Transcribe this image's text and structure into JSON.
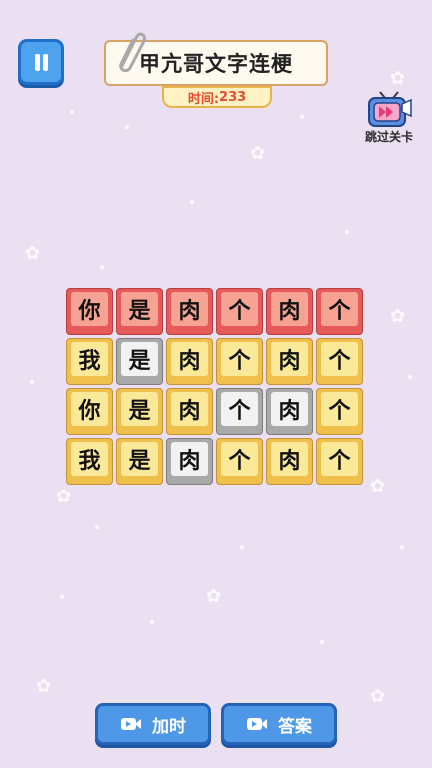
{
  "header": {
    "title": "甲亢哥文字连梗",
    "timer_label": "时间:",
    "timer_value": "233",
    "pause_icon": "pause-icon",
    "clip_icon": "paperclip-icon"
  },
  "skip": {
    "label": "跳过关卡",
    "icon": "tv-fast-forward-icon"
  },
  "grid": {
    "rows": [
      [
        {
          "char": "你",
          "state": "red"
        },
        {
          "char": "是",
          "state": "red"
        },
        {
          "char": "肉",
          "state": "red"
        },
        {
          "char": "个",
          "state": "red"
        },
        {
          "char": "肉",
          "state": "red"
        },
        {
          "char": "个",
          "state": "red"
        }
      ],
      [
        {
          "char": "我",
          "state": "yellow"
        },
        {
          "char": "是",
          "state": "gray"
        },
        {
          "char": "肉",
          "state": "yellow"
        },
        {
          "char": "个",
          "state": "yellow"
        },
        {
          "char": "肉",
          "state": "yellow"
        },
        {
          "char": "个",
          "state": "yellow"
        }
      ],
      [
        {
          "char": "你",
          "state": "yellow"
        },
        {
          "char": "是",
          "state": "yellow"
        },
        {
          "char": "肉",
          "state": "yellow"
        },
        {
          "char": "个",
          "state": "gray"
        },
        {
          "char": "肉",
          "state": "gray"
        },
        {
          "char": "个",
          "state": "yellow"
        }
      ],
      [
        {
          "char": "我",
          "state": "yellow"
        },
        {
          "char": "是",
          "state": "yellow"
        },
        {
          "char": "肉",
          "state": "gray"
        },
        {
          "char": "个",
          "state": "yellow"
        },
        {
          "char": "肉",
          "state": "yellow"
        },
        {
          "char": "个",
          "state": "yellow"
        }
      ]
    ]
  },
  "buttons": {
    "add_time": {
      "label": "加时",
      "icon": "video-icon"
    },
    "answer": {
      "label": "答案",
      "icon": "video-icon"
    }
  },
  "colors": {
    "background": "#ebe0f1",
    "button_blue": "#4f98e8",
    "tile_red": "#e65a5a",
    "tile_yellow": "#f0c04c",
    "tile_gray": "#a9a9a9",
    "timer_text": "#e84a2a"
  }
}
